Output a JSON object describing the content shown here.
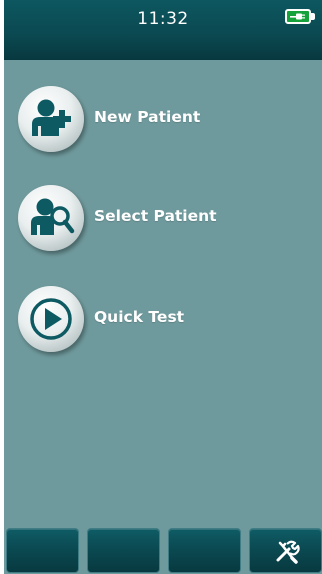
{
  "status_bar": {
    "time": "11:32",
    "battery_icon": "battery-charging-icon",
    "battery_color": "#16a23a"
  },
  "menu": {
    "items": [
      {
        "label": "New Patient",
        "icon": "add-patient-icon"
      },
      {
        "label": "Select Patient",
        "icon": "search-patient-icon"
      },
      {
        "label": "Quick Test",
        "icon": "play-icon"
      }
    ]
  },
  "softkeys": [
    {
      "icon": ""
    },
    {
      "icon": ""
    },
    {
      "icon": ""
    },
    {
      "icon": "tools-icon"
    }
  ],
  "colors": {
    "screen_background": "#6f9a9d",
    "header_background": "#0b4a52",
    "softkey_background": "#0b4a52",
    "icon_foreground": "#0d5a63"
  }
}
